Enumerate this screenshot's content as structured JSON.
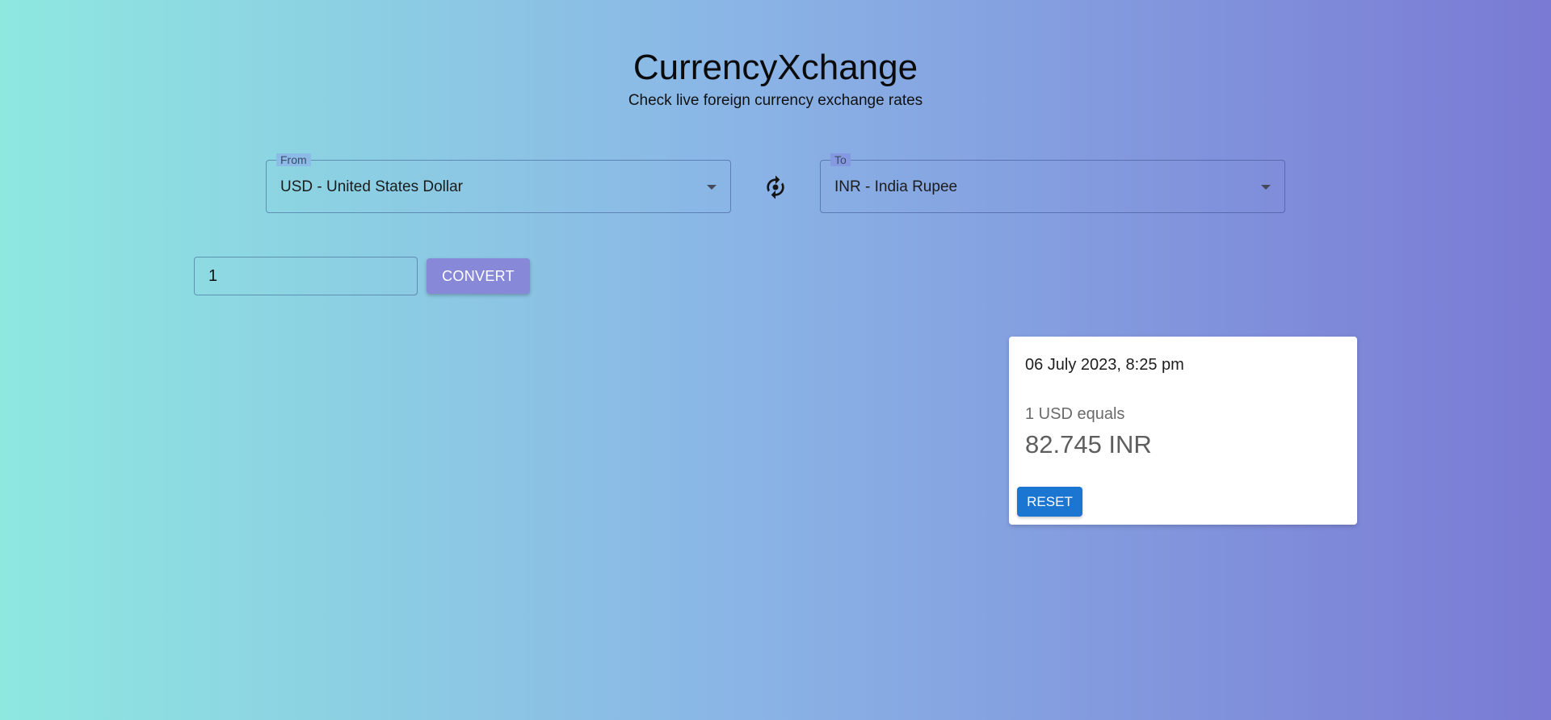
{
  "app": {
    "title": "CurrencyXchange",
    "subtitle": "Check live foreign currency exchange rates"
  },
  "from": {
    "label": "From",
    "value": "USD - United States Dollar"
  },
  "to": {
    "label": "To",
    "value": "INR - India Rupee"
  },
  "swap": {
    "icon": "swap-currency-icon"
  },
  "amount": {
    "value": "1"
  },
  "convert": {
    "label": "CONVERT"
  },
  "result": {
    "timestamp": "06 July 2023, 8:25 pm",
    "equals_text": "1 USD equals",
    "value": "82.745 INR",
    "reset_label": "RESET"
  },
  "colors": {
    "gradient_start": "#8ee8e0",
    "gradient_end": "#7a7ad4",
    "convert_button": "#8888d8",
    "reset_button": "#1b76d2"
  }
}
